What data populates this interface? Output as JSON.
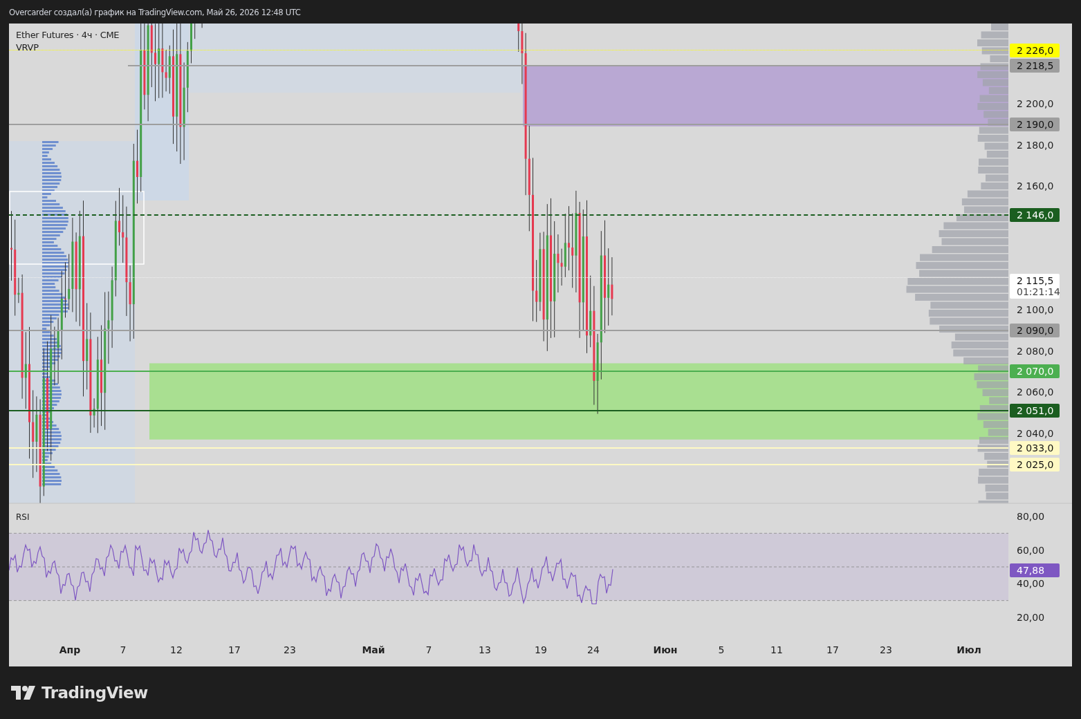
{
  "header": {
    "text": "Overcarder создал(а) график на TradingView.com, Май 26, 2026 12:48 UTC"
  },
  "legend": {
    "symbol": "Ether Futures · 4ч · CME",
    "indicator": "VRVP"
  },
  "price_axis": {
    "ticks": [
      "2 200,0",
      "2 180,0",
      "2 160,0",
      "2 100,0",
      "2 080,0",
      "2 060,0",
      "2 040,0"
    ],
    "badges": [
      {
        "kind": "level",
        "price": "2 226,0",
        "color": "#ffff00",
        "dashed": false,
        "dotted": true
      },
      {
        "kind": "level",
        "price": "2 218,5",
        "color": "#9e9e9e",
        "dashed": false,
        "dotted": false
      },
      {
        "kind": "level",
        "price": "2 190,0",
        "color": "#9e9e9e",
        "dashed": false,
        "dotted": false
      },
      {
        "kind": "level",
        "price": "2 146,0",
        "color": "#1b5e20",
        "dashed": true,
        "dotted": false
      },
      {
        "kind": "last_price",
        "price": "2 115,5",
        "countdown": "01:21:14",
        "color": "#ffffff",
        "dashed": false,
        "dotted": true
      },
      {
        "kind": "level",
        "price": "2 090,0",
        "color": "#9e9e9e",
        "dashed": false,
        "dotted": false
      },
      {
        "kind": "level",
        "price": "2 070,0",
        "color": "#4caf50",
        "dashed": false,
        "dotted": false
      },
      {
        "kind": "level",
        "price": "2 051,0",
        "color": "#1b5e20",
        "dashed": false,
        "dotted": false
      },
      {
        "kind": "level",
        "price": "2 033,0",
        "color": "#fff9c4",
        "dashed": false,
        "dotted": false
      },
      {
        "kind": "level",
        "price": "2 025,0",
        "color": "#fff9c4",
        "dashed": false,
        "dotted": false
      }
    ]
  },
  "rsi": {
    "label": "RSI",
    "ticks": [
      "80,00",
      "60,00",
      "40,00",
      "20,00"
    ],
    "value": "47,88",
    "color": "#7e57c2"
  },
  "time_axis": [
    {
      "kind": "month",
      "label": "Апр"
    },
    {
      "kind": "day",
      "label": "7"
    },
    {
      "kind": "day",
      "label": "12"
    },
    {
      "kind": "day",
      "label": "17"
    },
    {
      "kind": "day",
      "label": "23"
    },
    {
      "kind": "month",
      "label": "Май"
    },
    {
      "kind": "day",
      "label": "7"
    },
    {
      "kind": "day",
      "label": "13"
    },
    {
      "kind": "day",
      "label": "19"
    },
    {
      "kind": "day",
      "label": "24"
    },
    {
      "kind": "month",
      "label": "Июн"
    },
    {
      "kind": "day",
      "label": "5"
    },
    {
      "kind": "day",
      "label": "11"
    },
    {
      "kind": "day",
      "label": "17"
    },
    {
      "kind": "day",
      "label": "23"
    },
    {
      "kind": "month",
      "label": "Июл"
    }
  ],
  "footer": {
    "logo_text": "TradingView"
  }
}
